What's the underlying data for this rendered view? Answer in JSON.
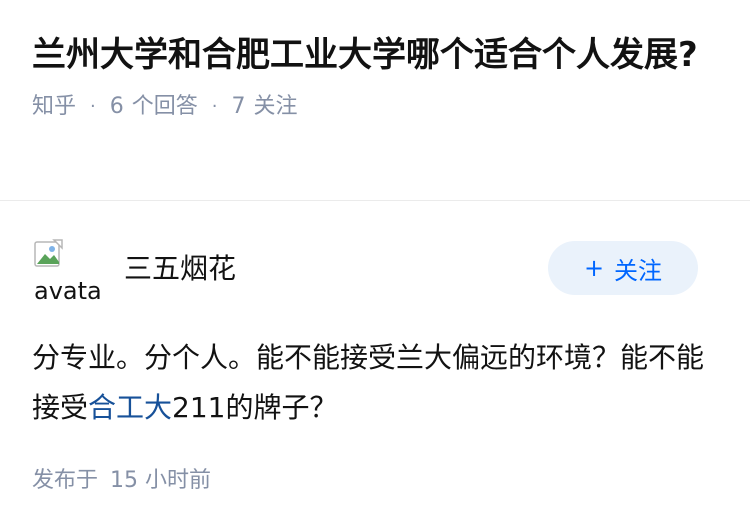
{
  "question": {
    "title": "兰州大学和合肥工业大学哪个适合个人发展?",
    "source": "知乎",
    "answer_count": "6",
    "answer_label": "个回答",
    "follow_count": "7",
    "follow_label": "关注"
  },
  "answer": {
    "author": {
      "name": "三五烟花",
      "avatar_alt": "avatar"
    },
    "follow_button": {
      "icon": "plus-icon",
      "label": "关注"
    },
    "content": {
      "part1": "分专业。分个人。能不能接受兰大偏远的环境？能不能接受",
      "link_text": "合工大",
      "part2": "211的牌子？"
    },
    "published": {
      "label": "发布于",
      "time": "15 小时前"
    }
  },
  "colors": {
    "accent": "#0066ff",
    "link": "#175199",
    "meta": "#8590a6",
    "follow_bg": "#eaf2fb"
  }
}
